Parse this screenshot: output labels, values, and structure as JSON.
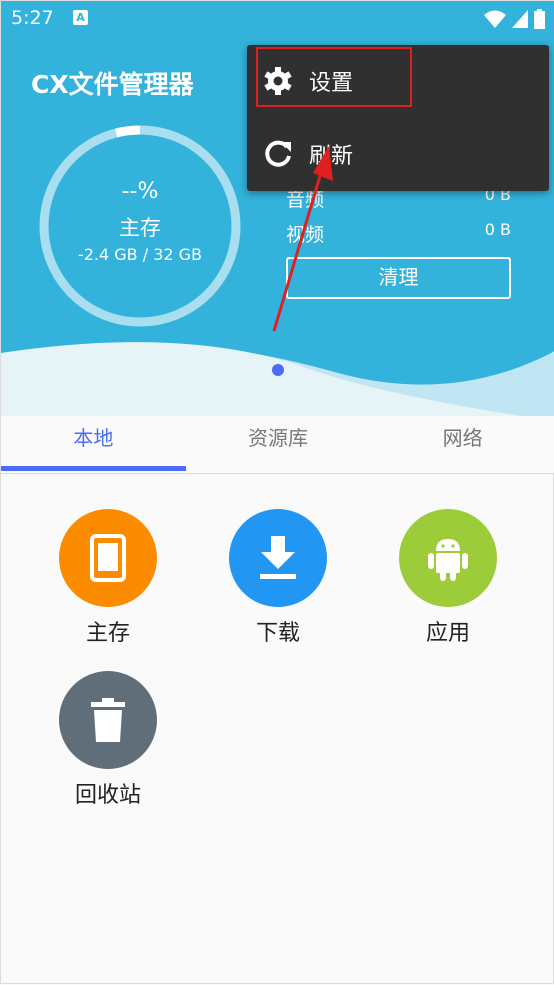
{
  "status_bar": {
    "time": "5:27",
    "notification_icon": "A"
  },
  "app": {
    "title": "CX文件管理器"
  },
  "storage": {
    "percent": "--%",
    "label": "主存",
    "size": "-2.4 GB / 32 GB",
    "used_fraction": 0.04
  },
  "stats": [
    {
      "label": "音频",
      "value": "0 B"
    },
    {
      "label": "视频",
      "value": "0 B"
    }
  ],
  "clean_button": "清理",
  "tabs": [
    {
      "label": "本地",
      "active": true
    },
    {
      "label": "资源库"
    },
    {
      "label": "网络"
    }
  ],
  "grid": [
    {
      "label": "主存",
      "icon": "tablet-icon",
      "color": "#fb8c00"
    },
    {
      "label": "下载",
      "icon": "download-icon",
      "color": "#2196f3"
    },
    {
      "label": "应用",
      "icon": "android-icon",
      "color": "#9ccc3a"
    },
    {
      "label": "回收站",
      "icon": "trash-icon",
      "color": "#5f6e78"
    }
  ],
  "menu": [
    {
      "label": "设置",
      "icon": "gear-icon"
    },
    {
      "label": "刷新",
      "icon": "refresh-icon"
    }
  ],
  "colors": {
    "header": "#33b3db",
    "accent": "#4a6cf7",
    "menu_bg": "#303030",
    "annotation": "#e02020"
  }
}
